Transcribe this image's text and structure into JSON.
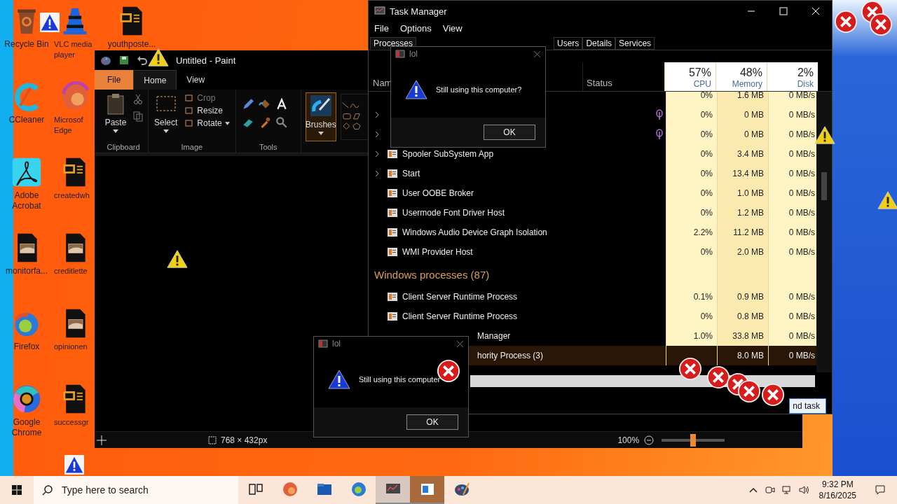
{
  "desktop": {
    "icons": [
      {
        "kind": "recycle",
        "label": "Recycle Bin"
      },
      {
        "kind": "vlc",
        "label": "VLC media player"
      },
      {
        "kind": "word",
        "label": "youthposte..."
      },
      {
        "kind": "ccleaner",
        "label": "CCleaner"
      },
      {
        "kind": "edge",
        "label": "Microsof Edge"
      },
      {
        "kind": "acrobat",
        "label": "Adobe Acrobat"
      },
      {
        "kind": "word",
        "label": "createdwh"
      },
      {
        "kind": "image",
        "label": "monitorfa..."
      },
      {
        "kind": "image",
        "label": "creditlette"
      },
      {
        "kind": "firefox",
        "label": "Firefox"
      },
      {
        "kind": "image",
        "label": "opinionen"
      },
      {
        "kind": "chrome",
        "label": "Google Chrome"
      },
      {
        "kind": "word",
        "label": "successgr"
      }
    ]
  },
  "paint": {
    "title": "Untitled - Paint",
    "tabs": [
      {
        "label": "File",
        "kind": "file",
        "selected": false
      },
      {
        "label": "Home",
        "kind": "tab",
        "selected": true
      },
      {
        "label": "View",
        "kind": "tab",
        "selected": false
      }
    ],
    "clipboard": {
      "paste": "Paste",
      "label": "Clipboard"
    },
    "image": {
      "select": "Select",
      "label": "Image",
      "actions": [
        {
          "label": "Crop",
          "disabled": true,
          "dropdown": false
        },
        {
          "label": "Resize",
          "disabled": false,
          "dropdown": false
        },
        {
          "label": "Rotate",
          "disabled": false,
          "dropdown": true
        }
      ]
    },
    "tools": {
      "label": "Tools"
    },
    "brushes": {
      "label": "Brushes",
      "selected": true
    },
    "status": {
      "size": "768 × 432px",
      "zoom": "100%",
      "level": 0.5
    }
  },
  "task_manager": {
    "title": "Task Manager",
    "menu": [
      "File",
      "Options",
      "View"
    ],
    "tabs": [
      {
        "label": "Processes",
        "selected": true
      },
      {
        "label": "Users",
        "selected": false
      },
      {
        "label": "Details",
        "selected": false
      },
      {
        "label": "Services",
        "selected": false
      }
    ],
    "columns": [
      {
        "label": "Nam"
      },
      {
        "label": "Status"
      },
      {
        "percent": "57%",
        "label": "CPU"
      },
      {
        "percent": "48%",
        "label": "Memory"
      },
      {
        "percent": "2%",
        "label": "Disk"
      }
    ],
    "rows": [
      {
        "kind": "process",
        "expandable": false,
        "efficiency": false,
        "selected": false,
        "partial": false,
        "cpu": "0%",
        "memory": "1.6 MB",
        "disk": "0 MB/s"
      },
      {
        "kind": "process",
        "expandable": true,
        "efficiency": true,
        "selected": false,
        "partial": false,
        "cpu": "0%",
        "memory": "0 MB",
        "disk": "0 MB/s"
      },
      {
        "kind": "process",
        "expandable": true,
        "efficiency": true,
        "selected": false,
        "partial": false,
        "cpu": "0%",
        "memory": "0 MB",
        "disk": "0 MB/s"
      },
      {
        "kind": "process",
        "name": "Spooler SubSystem App",
        "expandable": true,
        "efficiency": false,
        "selected": false,
        "partial": false,
        "cpu": "0%",
        "memory": "3.4 MB",
        "disk": "0 MB/s"
      },
      {
        "kind": "process",
        "name": "Start",
        "expandable": true,
        "efficiency": false,
        "selected": false,
        "partial": false,
        "cpu": "0%",
        "memory": "13.4 MB",
        "disk": "0 MB/s"
      },
      {
        "kind": "process",
        "name": "User OOBE Broker",
        "expandable": false,
        "efficiency": false,
        "selected": false,
        "partial": false,
        "cpu": "0%",
        "memory": "1.0 MB",
        "disk": "0 MB/s"
      },
      {
        "kind": "process",
        "name": "Usermode Font Driver Host",
        "expandable": false,
        "efficiency": false,
        "selected": false,
        "partial": false,
        "cpu": "0%",
        "memory": "1.2 MB",
        "disk": "0 MB/s"
      },
      {
        "kind": "process",
        "name": "Windows Audio Device Graph Isolation",
        "expandable": false,
        "efficiency": false,
        "selected": false,
        "partial": false,
        "cpu": "2.2%",
        "memory": "11.2 MB",
        "disk": "0 MB/s"
      },
      {
        "kind": "process",
        "name": "WMI Provider Host",
        "expandable": false,
        "efficiency": false,
        "selected": false,
        "partial": false,
        "cpu": "0%",
        "memory": "2.0 MB",
        "disk": "0 MB/s"
      },
      {
        "kind": "group",
        "name": "Windows processes (87)"
      },
      {
        "kind": "process",
        "name": "Client Server Runtime Process",
        "expandable": false,
        "efficiency": false,
        "selected": false,
        "partial": false,
        "cpu": "0.1%",
        "memory": "0.9 MB",
        "disk": "0 MB/s"
      },
      {
        "kind": "process",
        "name": "Client Server Runtime Process",
        "expandable": false,
        "efficiency": false,
        "selected": false,
        "partial": false,
        "cpu": "0%",
        "memory": "0.8 MB",
        "disk": "0 MB/s"
      },
      {
        "kind": "process",
        "name": "Manager",
        "expandable": false,
        "efficiency": false,
        "selected": false,
        "partial": true,
        "cpu": "1.0%",
        "memory": "33.8 MB",
        "disk": "0 MB/s"
      },
      {
        "kind": "process",
        "name": "hority Process (3)",
        "expandable": false,
        "efficiency": false,
        "selected": true,
        "partial": true,
        "memory": "8.0 MB",
        "disk": "0 MB/s"
      }
    ],
    "end_task": "nd task"
  },
  "dialogs": [
    {
      "title": "lol",
      "message": "Still using this computer?",
      "button": "OK"
    },
    {
      "title": "lol",
      "message": "Still using this computer",
      "button": "OK"
    }
  ],
  "taskbar": {
    "search": {
      "placeholder": "Type here to search"
    },
    "apps": [
      {
        "kind": "taskview",
        "active": false
      },
      {
        "kind": "edge",
        "active": false
      },
      {
        "kind": "explorer",
        "active": false
      },
      {
        "kind": "firefox",
        "active": false
      },
      {
        "kind": "taskmgr",
        "active": true
      },
      {
        "kind": "doc",
        "active": true
      },
      {
        "kind": "paint",
        "active": false
      }
    ],
    "time": "9:32 PM",
    "date": "8/16/2025"
  }
}
